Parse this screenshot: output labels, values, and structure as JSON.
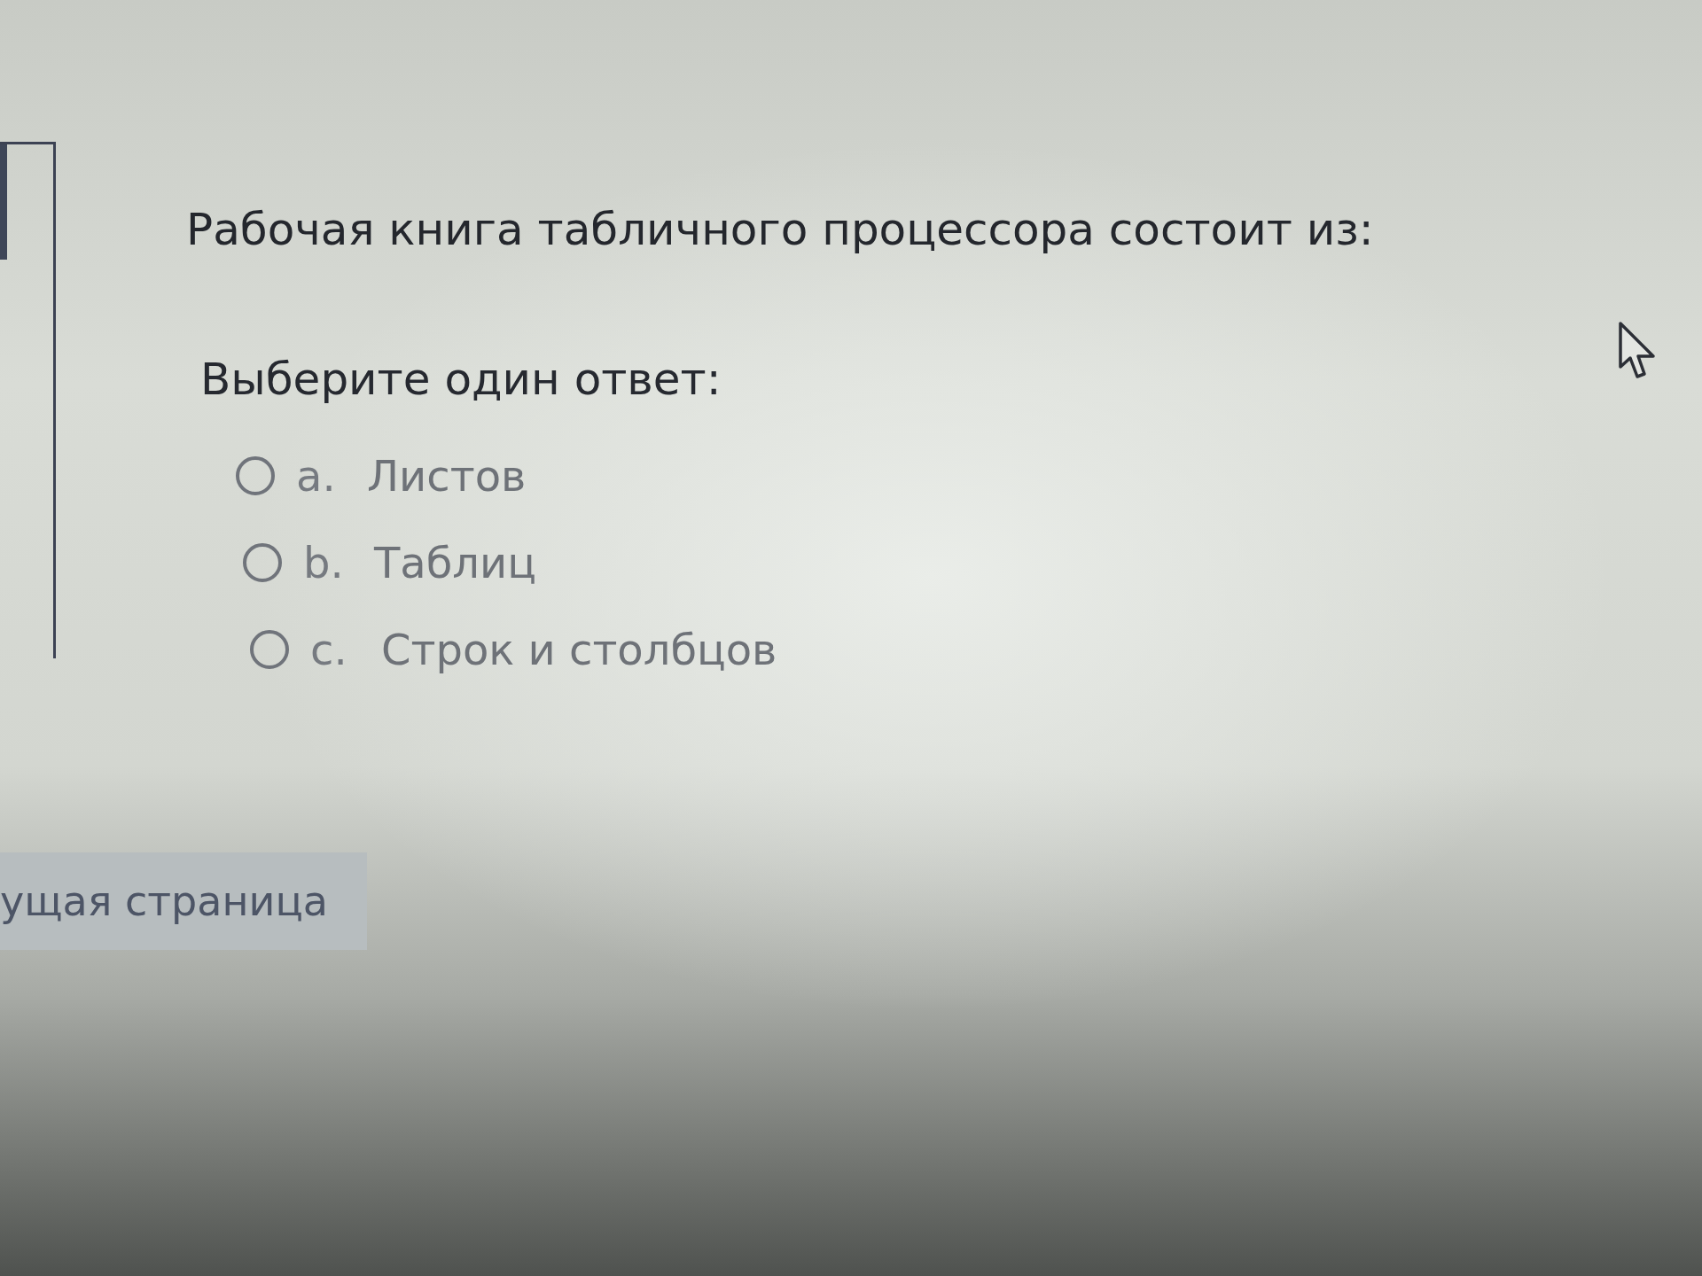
{
  "question": {
    "text": "Рабочая книга табличного процессора состоит из:",
    "prompt": "Выберите один ответ:",
    "options": [
      {
        "letter": "a.",
        "label": "Листов",
        "selected": false
      },
      {
        "letter": "b.",
        "label": "Таблиц",
        "selected": false
      },
      {
        "letter": "c.",
        "label": "Строк и столбцов",
        "selected": false
      }
    ]
  },
  "navigation": {
    "next_button": "ущая страница"
  }
}
